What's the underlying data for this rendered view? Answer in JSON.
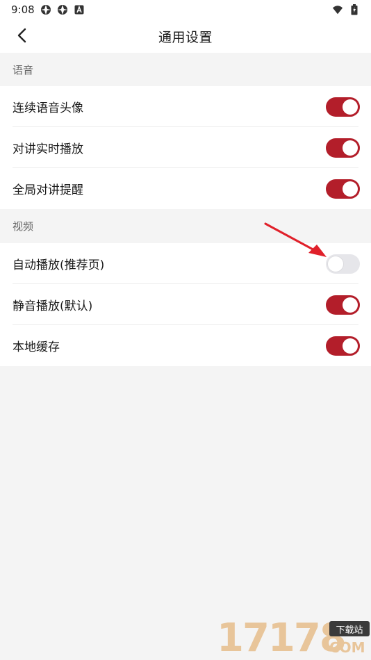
{
  "status_bar": {
    "time": "9:08",
    "icons_left": [
      "aperture-icon",
      "aperture-icon",
      "a-notification-icon"
    ],
    "icons_right": [
      "wifi-icon",
      "battery-charging-icon"
    ]
  },
  "header": {
    "title": "通用设置",
    "back_icon": "chevron-left-icon"
  },
  "sections": [
    {
      "title": "语音",
      "items": [
        {
          "label": "连续语音头像",
          "enabled": true
        },
        {
          "label": "对讲实时播放",
          "enabled": true
        },
        {
          "label": "全局对讲提醒",
          "enabled": true
        }
      ]
    },
    {
      "title": "视频",
      "items": [
        {
          "label": "自动播放(推荐页)",
          "enabled": false
        },
        {
          "label": "静音播放(默认)",
          "enabled": true
        },
        {
          "label": "本地缓存",
          "enabled": true
        }
      ]
    }
  ],
  "colors": {
    "accent": "#b31e2a",
    "toggle_off": "#e6e6ea",
    "background": "#f4f4f4",
    "annotation_arrow": "#e0202a"
  },
  "watermark": {
    "digits": "17178",
    "badge": "下载站",
    "suffix": "COM"
  }
}
